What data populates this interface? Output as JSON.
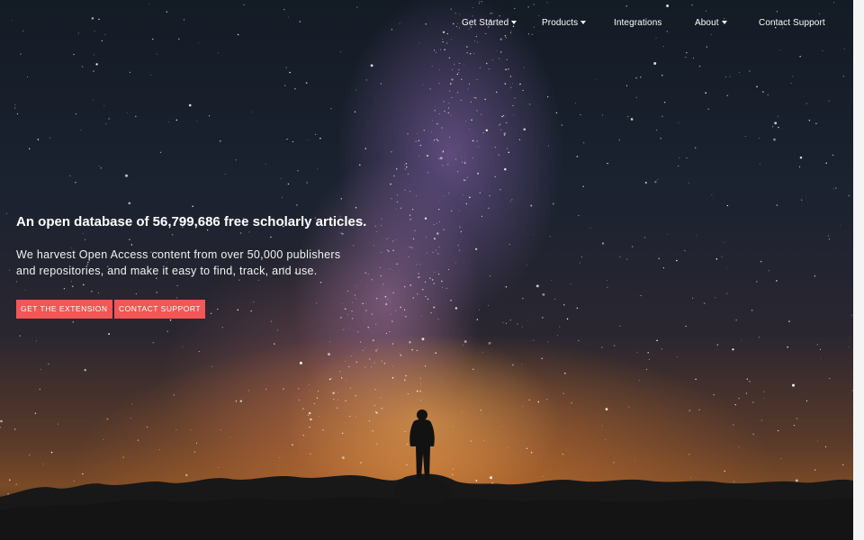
{
  "nav": {
    "items": [
      {
        "label": "Get Started",
        "dropdown": true
      },
      {
        "label": "Products",
        "dropdown": true
      },
      {
        "label": "Integrations",
        "dropdown": false
      },
      {
        "label": "About",
        "dropdown": true
      },
      {
        "label": "Contact Support",
        "dropdown": false
      }
    ]
  },
  "hero": {
    "headline": "An open database of 56,799,686 free scholarly articles.",
    "subtext": "We harvest Open Access content from over 50,000 publishers and repositories, and make it easy to find, track, and use.",
    "primary_button": "GET THE EXTENSION",
    "secondary_button": "CONTACT SUPPORT"
  },
  "colors": {
    "button": "#f25656",
    "text": "#ffffff"
  },
  "icons": {
    "dropdown": "chevron-down-icon"
  }
}
